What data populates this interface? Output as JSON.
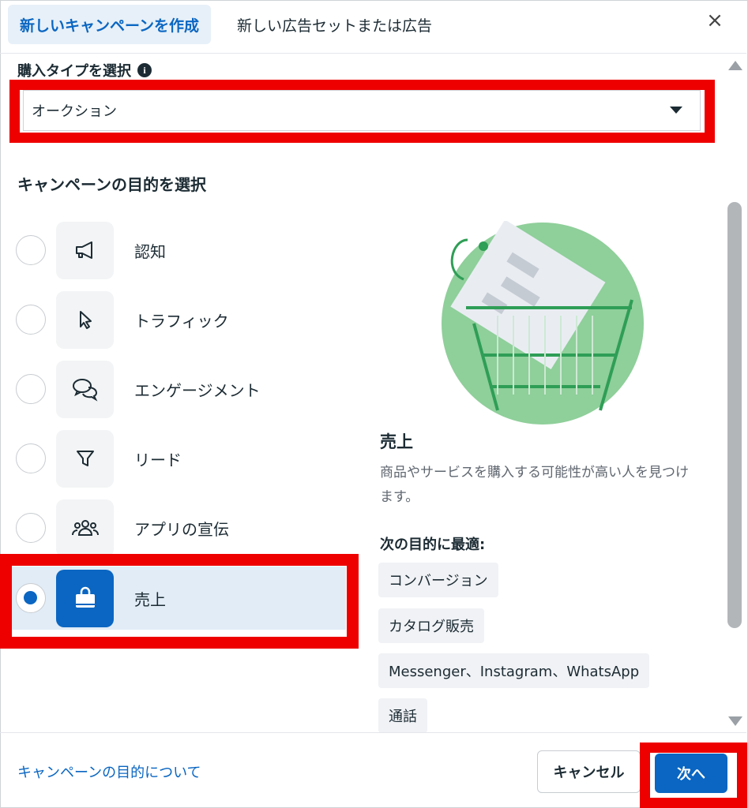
{
  "header": {
    "tab_active": "新しいキャンペーンを作成",
    "tab_other": "新しい広告セットまたは広告",
    "close": "×"
  },
  "purchase_type": {
    "label": "購入タイプを選択",
    "info": "i",
    "selected": "オークション"
  },
  "objective_heading": "キャンペーンの目的を選択",
  "objectives": [
    {
      "label": "認知",
      "icon": "megaphone-icon",
      "checked": false
    },
    {
      "label": "トラフィック",
      "icon": "cursor-icon",
      "checked": false
    },
    {
      "label": "エンゲージメント",
      "icon": "chat-bubbles-icon",
      "checked": false
    },
    {
      "label": "リード",
      "icon": "funnel-icon",
      "checked": false
    },
    {
      "label": "アプリの宣伝",
      "icon": "people-icon",
      "checked": false
    },
    {
      "label": "売上",
      "icon": "shopping-bag-icon",
      "checked": true
    }
  ],
  "detail": {
    "title": "売上",
    "description": "商品やサービスを購入する可能性が高い人を見つけます。",
    "best_for_label": "次の目的に最適:",
    "chips": [
      "コンバージョン",
      "カタログ販売",
      "Messenger、Instagram、WhatsApp",
      "通話"
    ]
  },
  "footer": {
    "link": "キャンペーンの目的について",
    "cancel": "キャンセル",
    "next": "次へ"
  },
  "colors": {
    "accent": "#0a66c2",
    "highlight": "#ee0000",
    "selected_bg": "#e1ecf7",
    "illustration_green": "#8fcf9a"
  }
}
